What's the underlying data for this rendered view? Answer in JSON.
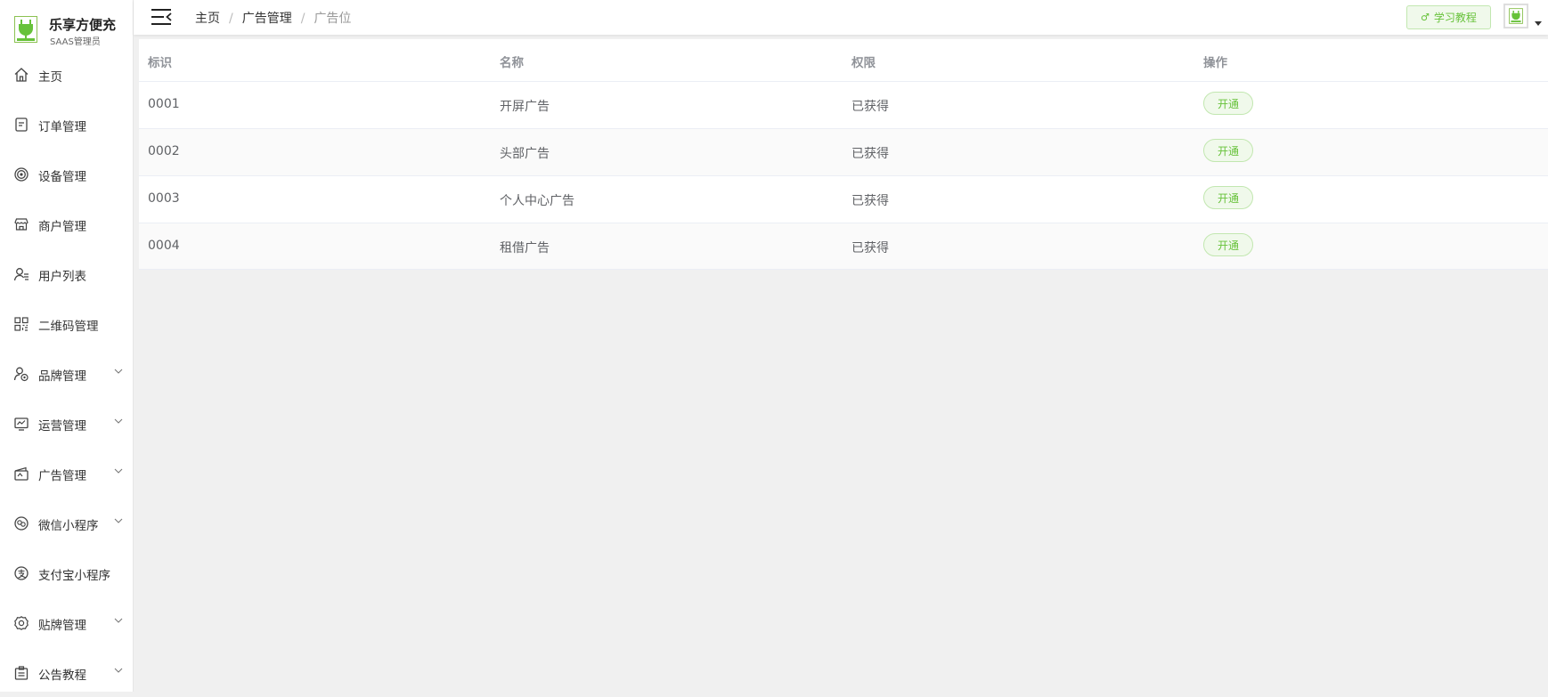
{
  "brand": {
    "name": "乐享方便充",
    "subtitle": "SAAS管理员"
  },
  "sidebar": {
    "items": [
      {
        "label": "主页",
        "icon": "home-icon",
        "has_submenu": false
      },
      {
        "label": "订单管理",
        "icon": "order-icon",
        "has_submenu": false
      },
      {
        "label": "设备管理",
        "icon": "device-icon",
        "has_submenu": false
      },
      {
        "label": "商户管理",
        "icon": "shop-icon",
        "has_submenu": false
      },
      {
        "label": "用户列表",
        "icon": "user-icon",
        "has_submenu": false
      },
      {
        "label": "二维码管理",
        "icon": "qrcode-icon",
        "has_submenu": false
      },
      {
        "label": "品牌管理",
        "icon": "brand-icon",
        "has_submenu": true
      },
      {
        "label": "运营管理",
        "icon": "operation-icon",
        "has_submenu": true
      },
      {
        "label": "广告管理",
        "icon": "ad-icon",
        "has_submenu": true
      },
      {
        "label": "微信小程序",
        "icon": "wechat-icon",
        "has_submenu": true
      },
      {
        "label": "支付宝小程序",
        "icon": "alipay-icon",
        "has_submenu": false
      },
      {
        "label": "贴牌管理",
        "icon": "settings-icon",
        "has_submenu": true
      },
      {
        "label": "公告教程",
        "icon": "notice-icon",
        "has_submenu": true
      }
    ]
  },
  "header": {
    "breadcrumb": [
      "主页",
      "广告管理",
      "广告位"
    ],
    "breadcrumb_sep": "/",
    "tutorial_label": "学习教程",
    "tutorial_icon": "♂"
  },
  "table": {
    "columns": [
      "标识",
      "名称",
      "权限",
      "操作"
    ],
    "rows": [
      {
        "id": "0001",
        "name": "开屏广告",
        "permission": "已获得",
        "action": "开通"
      },
      {
        "id": "0002",
        "name": "头部广告",
        "permission": "已获得",
        "action": "开通"
      },
      {
        "id": "0003",
        "name": "个人中心广告",
        "permission": "已获得",
        "action": "开通"
      },
      {
        "id": "0004",
        "name": "租借广告",
        "permission": "已获得",
        "action": "开通"
      }
    ]
  },
  "colors": {
    "accent": "#67c23a",
    "accent_bg": "#f0f9eb",
    "accent_border": "#c2e7b0"
  }
}
